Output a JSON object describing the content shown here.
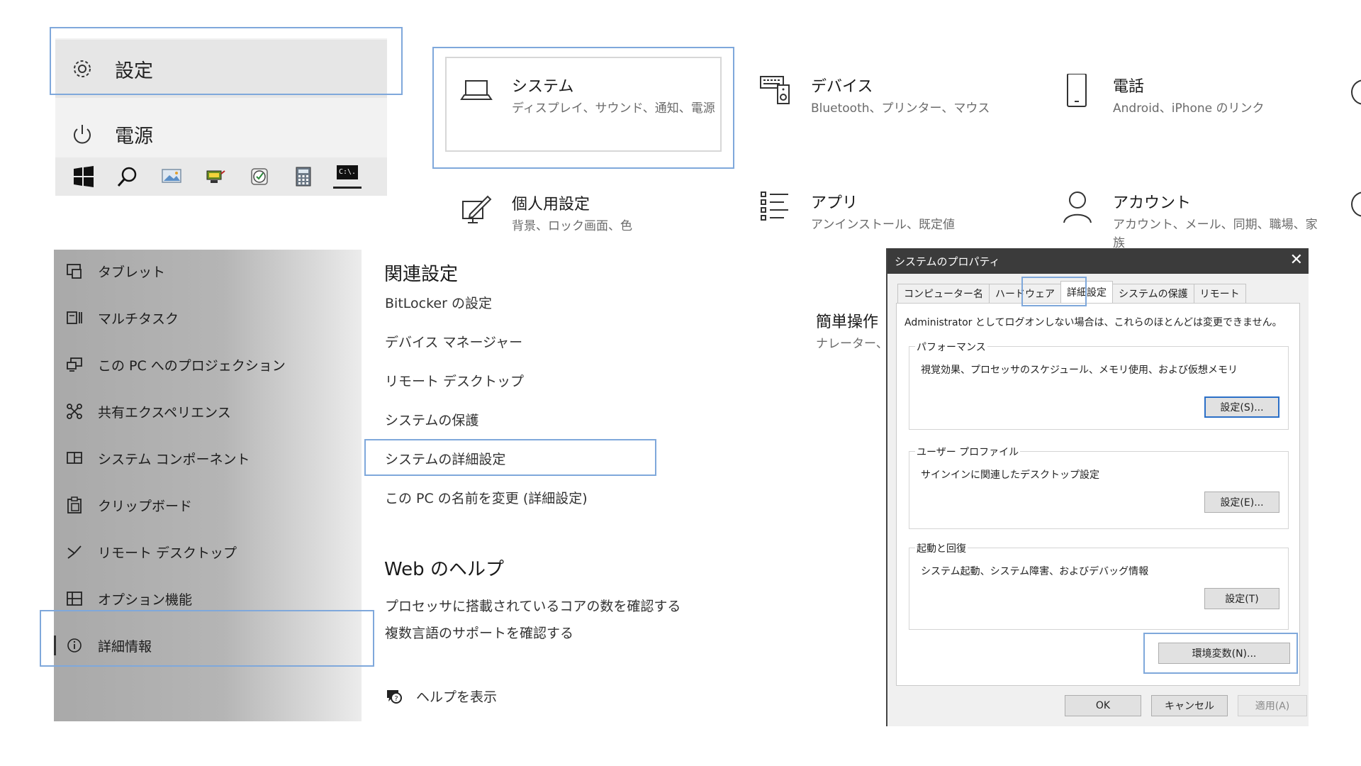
{
  "start_menu": {
    "settings_label": "設定",
    "power_label": "電源",
    "taskbar_icons": [
      "windows-start-icon",
      "search-icon",
      "photo-app-icon",
      "tablet-pc-icon",
      "clock-app-icon",
      "calculator-icon",
      "command-prompt-icon"
    ],
    "cmd_icon_text": "C:\\."
  },
  "settings_categories": [
    {
      "title": "システム",
      "subtitle": "ディスプレイ、サウンド、通知、電源",
      "icon": "laptop-icon"
    },
    {
      "title": "デバイス",
      "subtitle": "Bluetooth、プリンター、マウス",
      "icon": "keyboard-speaker-icon"
    },
    {
      "title": "電話",
      "subtitle": "Android、iPhone のリンク",
      "icon": "phone-icon"
    },
    {
      "title": "個人用設定",
      "subtitle": "背景、ロック画面、色",
      "icon": "pen-screen-icon"
    },
    {
      "title": "アプリ",
      "subtitle": "アンインストール、既定値",
      "icon": "apps-list-icon"
    },
    {
      "title": "アカウント",
      "subtitle_line1": "アカウント、メール、同期、職場、家",
      "subtitle_line2": "族",
      "icon": "person-icon"
    },
    {
      "title": "簡単操作",
      "subtitle": "ナレーター、拡"
    }
  ],
  "about_nav": [
    {
      "label": "タブレット",
      "icon": "tablet-icon"
    },
    {
      "label": "マルチタスク",
      "icon": "multitask-icon"
    },
    {
      "label": "この PC へのプロジェクション",
      "icon": "projection-icon"
    },
    {
      "label": "共有エクスペリエンス",
      "icon": "shared-experience-icon"
    },
    {
      "label": "システム コンポーネント",
      "icon": "system-components-icon"
    },
    {
      "label": "クリップボード",
      "icon": "clipboard-icon"
    },
    {
      "label": "リモート デスクトップ",
      "icon": "remote-desktop-icon"
    },
    {
      "label": "オプション機能",
      "icon": "optional-features-icon"
    },
    {
      "label": "詳細情報",
      "icon": "info-icon"
    }
  ],
  "related": {
    "title": "関連設定",
    "links": [
      "BitLocker の設定",
      "デバイス マネージャー",
      "リモート デスクトップ",
      "システムの保護",
      "システムの詳細設定",
      "この PC の名前を変更 (詳細設定)"
    ]
  },
  "web_help": {
    "title": "Web のヘルプ",
    "links": [
      "プロセッサに搭載されているコアの数を確認する",
      "複数言語のサポートを確認する"
    ],
    "show_help": "ヘルプを表示"
  },
  "system_properties": {
    "title": "システムのプロパティ",
    "close": "✕",
    "tabs": [
      "コンピューター名",
      "ハードウェア",
      "詳細設定",
      "システムの保護",
      "リモート"
    ],
    "active_tab": "詳細設定",
    "admin_note": "Administrator としてログオンしない場合は、これらのほとんどは変更できません。",
    "groups": [
      {
        "caption": "パフォーマンス",
        "desc": "視覚効果、プロセッサのスケジュール、メモリ使用、および仮想メモリ",
        "button": "設定(S)..."
      },
      {
        "caption": "ユーザー プロファイル",
        "desc": "サインインに関連したデスクトップ設定",
        "button": "設定(E)..."
      },
      {
        "caption": "起動と回復",
        "desc": "システム起動、システム障害、およびデバッグ情報",
        "button": "設定(T)"
      }
    ],
    "env_button": "環境変数(N)...",
    "ok": "OK",
    "cancel": "キャンセル",
    "apply": "適用(A)"
  },
  "colors": {
    "highlight_border": "#7fa8db",
    "dialog_titlebar": "#3b3b3b",
    "primary_button_border": "#2b6fc7"
  }
}
